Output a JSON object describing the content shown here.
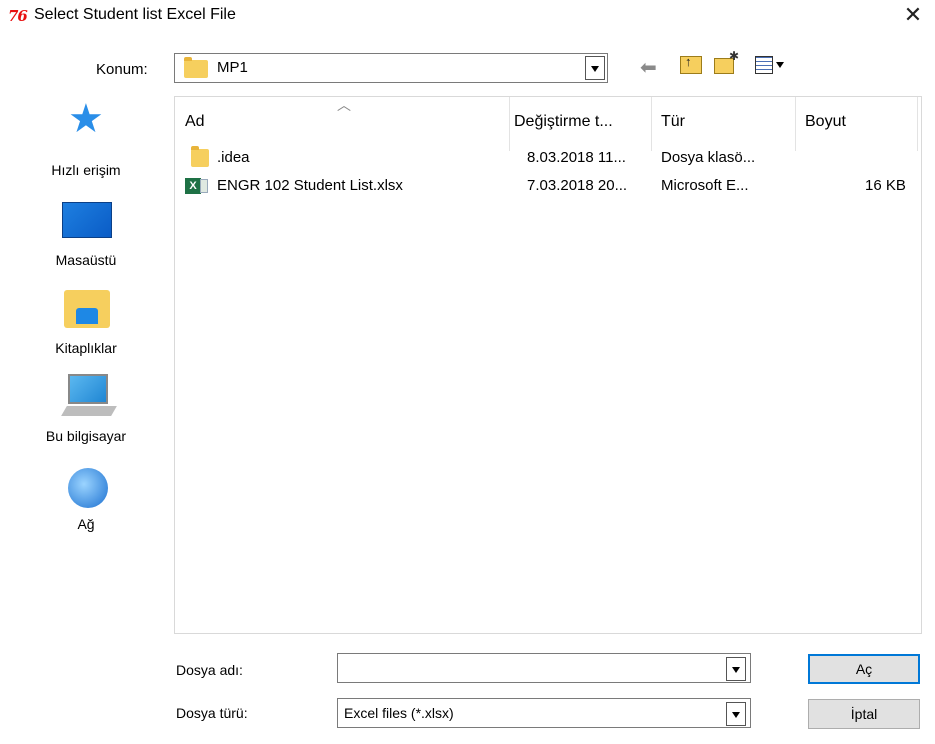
{
  "window": {
    "title": "Select Student list Excel File",
    "app_icon_text": "76",
    "close_glyph": "✕"
  },
  "location": {
    "label": "Konum:",
    "value": "MP1"
  },
  "places": [
    {
      "label": "Hızlı erişim",
      "icon": "quick-access-star-icon"
    },
    {
      "label": "Masaüstü",
      "icon": "desktop-icon"
    },
    {
      "label": "Kitaplıklar",
      "icon": "libraries-icon"
    },
    {
      "label": "Bu bilgisayar",
      "icon": "this-pc-icon"
    },
    {
      "label": "Ağ",
      "icon": "network-icon"
    }
  ],
  "columns": {
    "name": "Ad",
    "modified": "Değiştirme t...",
    "type": "Tür",
    "size": "Boyut"
  },
  "files": [
    {
      "name": ".idea",
      "modified": "8.03.2018 11...",
      "type": "Dosya klasö...",
      "size": "",
      "icon": "folder-icon"
    },
    {
      "name": "ENGR 102 Student List.xlsx",
      "modified": "7.03.2018 20...",
      "type": "Microsoft E...",
      "size": "16 KB",
      "icon": "excel-file-icon"
    }
  ],
  "filename": {
    "label": "Dosya adı:",
    "value": ""
  },
  "filetype": {
    "label": "Dosya türü:",
    "value": "Excel files (*.xlsx)"
  },
  "buttons": {
    "open": "Aç",
    "cancel": "İptal"
  },
  "colors": {
    "app_icon": "#e81010",
    "folder": "#f6cf5e",
    "excel": "#1e7145",
    "default_button_border": "#0078d7"
  }
}
